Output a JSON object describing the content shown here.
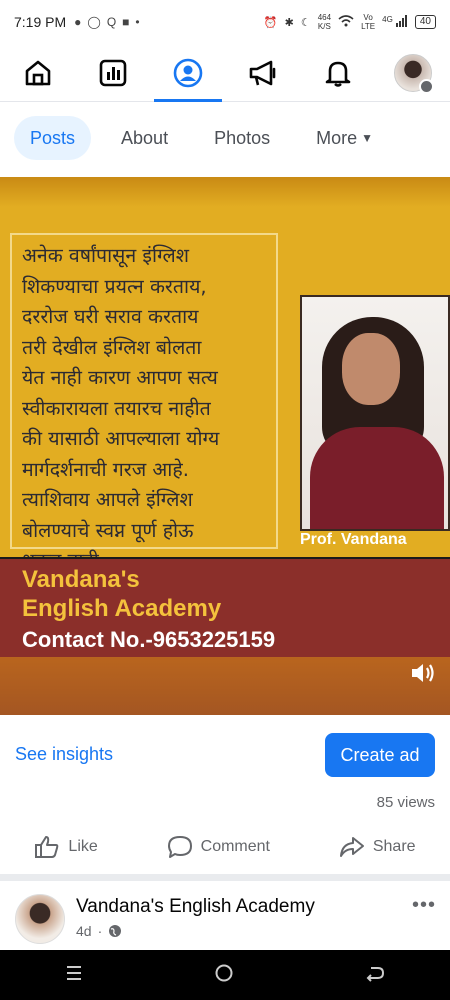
{
  "status_bar": {
    "time": "7:19 PM",
    "speed_top": "464",
    "speed_bottom": "K/S",
    "vo": "Vo",
    "lte": "LTE",
    "net": "4G",
    "battery": "40"
  },
  "nav": {
    "icons": [
      "home-icon",
      "dashboard-icon",
      "profile-icon",
      "megaphone-icon",
      "bell-icon",
      "avatar"
    ],
    "active": "profile-icon"
  },
  "tabs": [
    {
      "label": "Posts",
      "active": true
    },
    {
      "label": "About",
      "active": false
    },
    {
      "label": "Photos",
      "active": false
    },
    {
      "label": "More",
      "active": false
    }
  ],
  "post_media": {
    "marathi_lines": [
      "अनेक वर्षांपासून इंग्लिश",
      "शिकण्याचा प्रयत्न करताय,",
      "दररोज घरी सराव करताय",
      "तरी देखील इंग्लिश बोलता",
      "येत नाही कारण आपण सत्य",
      "स्वीकारायला तयारच नाहीत",
      "की यासाठी आपल्याला योग्य",
      "मार्गदर्शनाची गरज आहे.",
      "त्याशिवाय आपले इंग्लिश",
      "बोलण्याचे स्वप्न पूर्ण होऊ",
      "शकत नाही."
    ],
    "photo_caption": "Prof. Vandana",
    "banner_line1": "Vandana's",
    "banner_line2": "English Academy",
    "banner_line3": "Contact No.-9653225159"
  },
  "actions": {
    "insights_label": "See insights",
    "create_ad_label": "Create ad",
    "views": "85 views",
    "like_label": "Like",
    "comment_label": "Comment",
    "share_label": "Share"
  },
  "next_post": {
    "page_name": "Vandana's English Academy",
    "time_ago": "4d",
    "more_label": "•••"
  },
  "colors": {
    "accent": "#1877f2",
    "media_yellow": "#e2ad22",
    "banner_maroon": "#8b2f2a"
  }
}
